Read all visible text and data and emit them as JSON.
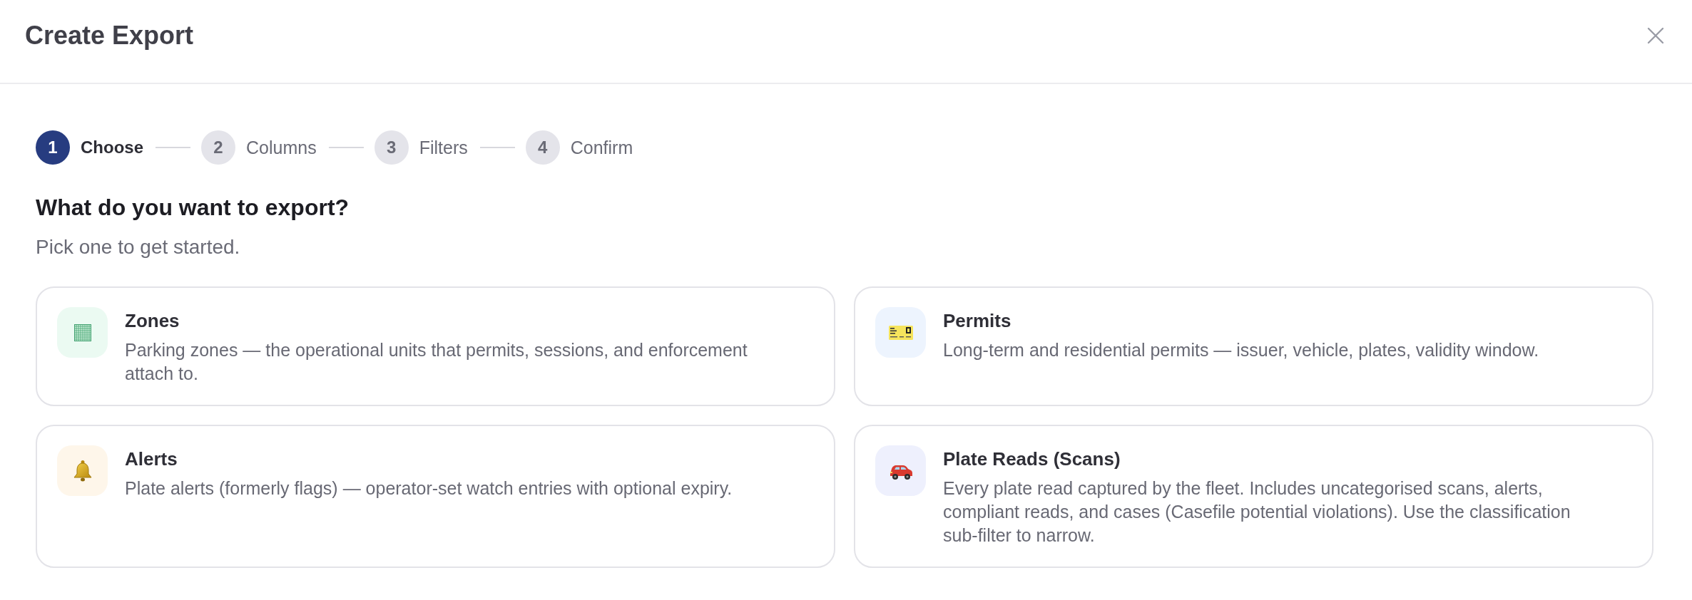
{
  "dialog": {
    "title": "Create Export"
  },
  "steps": [
    {
      "number": "1",
      "label": "Choose",
      "current": true
    },
    {
      "number": "2",
      "label": "Columns",
      "current": false
    },
    {
      "number": "3",
      "label": "Filters",
      "current": false
    },
    {
      "number": "4",
      "label": "Confirm",
      "current": false
    }
  ],
  "question": {
    "heading": "What do you want to export?",
    "subheading": "Pick one to get started."
  },
  "options": [
    {
      "title": "Zones",
      "description": "Parking zones — the operational units that permits, sessions, and enforcement attach to.",
      "selected": false
    },
    {
      "title": "Permits",
      "description": "Long-term and residential permits — issuer, vehicle, plates, validity window.",
      "selected": false
    },
    {
      "title": "Alerts",
      "description": "Plate alerts (formerly flags) — operator-set watch entries with optional expiry.",
      "selected": false
    },
    {
      "title": "Plate Reads (Scans)",
      "description": "Every plate read captured by the fleet. Includes uncategorised scans, alerts, compliant reads, and cases (Casefile potential violations). Use the classification sub-filter to narrow.",
      "selected": false
    }
  ]
}
